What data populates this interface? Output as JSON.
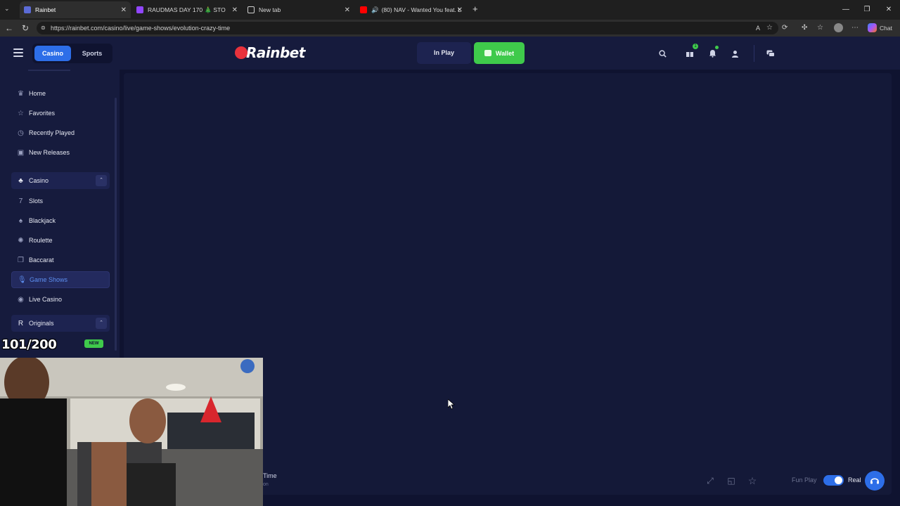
{
  "browser": {
    "tabs": [
      {
        "label": "Rainbet",
        "favicon_color": "#5b6bd6"
      },
      {
        "label": "RAUDMAS DAY 170 🎄 STO",
        "favicon_color": "#9146ff"
      },
      {
        "label": "New tab",
        "favicon_color": "#cfcfcf"
      },
      {
        "label": "(80) NAV - Wanted You feat. L",
        "favicon_color": "#ff0000"
      }
    ],
    "url": "https://rainbet.com/casino/live/game-shows/evolution-crazy-time",
    "chat_label": "Chat"
  },
  "header": {
    "casino_label": "Casino",
    "sports_label": "Sports",
    "logo_text": "Rainbet",
    "inplay_label": "In Play",
    "wallet_label": "Wallet",
    "gift_badge": "1"
  },
  "sidebar": {
    "items": [
      {
        "label": "Home",
        "icon": "crown-icon"
      },
      {
        "label": "Favorites",
        "icon": "star-icon"
      },
      {
        "label": "Recently Played",
        "icon": "history-icon"
      },
      {
        "label": "New Releases",
        "icon": "new-icon"
      }
    ],
    "casino_section": "Casino",
    "casino_items": [
      {
        "label": "Slots"
      },
      {
        "label": "Blackjack"
      },
      {
        "label": "Roulette"
      },
      {
        "label": "Baccarat"
      },
      {
        "label": "Game Shows"
      },
      {
        "label": "Live Casino"
      }
    ],
    "originals_section": "Originals"
  },
  "overlay": {
    "counter": "101/200",
    "new_badge": "NEW",
    "cam_text": "Time",
    "cam_text2": "on"
  },
  "game": {
    "fun_play_label": "Fun Play",
    "real_play_label": "Real",
    "real_play_toggle_on": true
  },
  "colors": {
    "accent": "#2d6ee8",
    "wallet": "#3fca4b",
    "bg": "#0f1330"
  }
}
